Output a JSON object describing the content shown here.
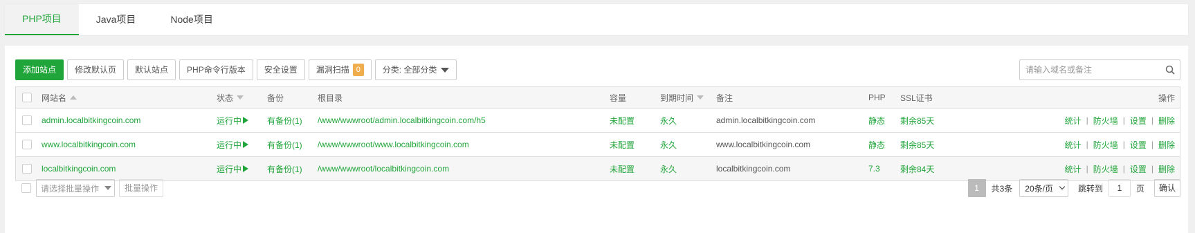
{
  "tabs": [
    {
      "label": "PHP项目",
      "active": true
    },
    {
      "label": "Java项目",
      "active": false
    },
    {
      "label": "Node项目",
      "active": false
    }
  ],
  "toolbar": {
    "add_site": "添加站点",
    "modify_default_page": "修改默认页",
    "default_site": "默认站点",
    "php_cli_version": "PHP命令行版本",
    "security_settings": "安全设置",
    "vuln_scan": "漏洞扫描",
    "vuln_scan_count": "0",
    "category": "分类: 全部分类"
  },
  "search": {
    "placeholder": "请输入域名或备注"
  },
  "table": {
    "headers": {
      "site_name": "网站名",
      "status": "状态",
      "backup": "备份",
      "root_dir": "根目录",
      "capacity": "容量",
      "expiry": "到期时间",
      "remark": "备注",
      "php": "PHP",
      "ssl": "SSL证书",
      "actions": "操作"
    },
    "rows": [
      {
        "site_name": "admin.localbitkingcoin.com",
        "status": "运行中",
        "backup": "有备份(1)",
        "root_dir": "/www/wwwroot/admin.localbitkingcoin.com/h5",
        "capacity": "未配置",
        "expiry": "永久",
        "remark": "admin.localbitkingcoin.com",
        "php": "静态",
        "ssl": "剩余85天",
        "actions": [
          "统计",
          "防火墙",
          "设置",
          "删除"
        ]
      },
      {
        "site_name": "www.localbitkingcoin.com",
        "status": "运行中",
        "backup": "有备份(1)",
        "root_dir": "/www/wwwroot/www.localbitkingcoin.com",
        "capacity": "未配置",
        "expiry": "永久",
        "remark": "www.localbitkingcoin.com",
        "php": "静态",
        "ssl": "剩余85天",
        "actions": [
          "统计",
          "防火墙",
          "设置",
          "删除"
        ]
      },
      {
        "site_name": "localbitkingcoin.com",
        "status": "运行中",
        "backup": "有备份(1)",
        "root_dir": "/www/wwwroot/localbitkingcoin.com",
        "capacity": "未配置",
        "expiry": "永久",
        "remark": "localbitkingcoin.com",
        "php": "7.3",
        "ssl": "剩余84天",
        "actions": [
          "统计",
          "防火墙",
          "设置",
          "删除"
        ]
      }
    ]
  },
  "footer": {
    "bulk_placeholder": "请选择批量操作",
    "bulk_button": "批量操作",
    "current_page": "1",
    "total": "共3条",
    "page_size": "20条/页",
    "jump_label": "跳转到",
    "jump_value": "1",
    "page_unit": "页",
    "confirm": "确认"
  },
  "colors": {
    "accent": "#20a53a",
    "badge": "#f0ad4e"
  }
}
